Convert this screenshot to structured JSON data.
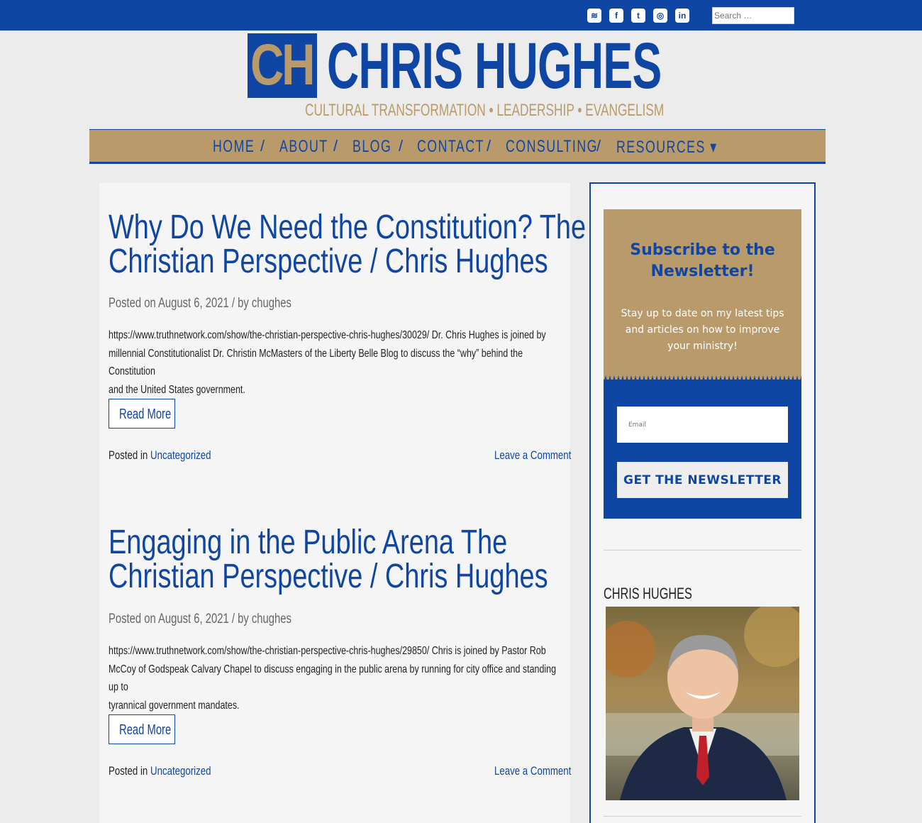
{
  "header": {
    "search_placeholder": "Search …",
    "social": [
      {
        "icon": "rss-icon",
        "glyph": "≋"
      },
      {
        "icon": "facebook-icon",
        "glyph": "f"
      },
      {
        "icon": "twitter-icon",
        "glyph": "t"
      },
      {
        "icon": "instagram-icon",
        "glyph": "◎"
      },
      {
        "icon": "linkedin-icon",
        "glyph": "in"
      }
    ]
  },
  "logo": {
    "initials": "CH",
    "name": "CHRIS HUGHES",
    "tagline": "CULTURAL TRANSFORMATION • LEADERSHIP • EVANGELISM"
  },
  "nav": {
    "items": [
      "HOME",
      "ABOUT",
      "BLOG",
      "CONTACT",
      "CONSULTING",
      "RESOURCES ▾"
    ],
    "separator": "/"
  },
  "posts": [
    {
      "title_line1": "Why Do We Need the Constitution? The",
      "title_line2": "Christian Perspective / Chris Hughes",
      "meta": "Posted on August 6, 2021 / by chughes",
      "excerpt_line1": "https://www.truthnetwork.com/show/the-christian-perspective-chris-hughes/30029/ Dr. Chris Hughes is joined by",
      "excerpt_line2": "millennial Constitutionalist Dr. Christin McMasters of the Liberty Belle Blog to discuss the “why” behind the Constitution",
      "excerpt_line3": "and the United States government.",
      "read_more": "Read More",
      "posted_in": "Posted in",
      "category": "Uncategorized",
      "comment": "Leave a Comment"
    },
    {
      "title_line1": "Engaging in the Public Arena The",
      "title_line2": "Christian Perspective / Chris Hughes",
      "meta": "Posted on August 6, 2021 / by chughes",
      "excerpt_line1": "https://www.truthnetwork.com/show/the-christian-perspective-chris-hughes/29850/ Chris is joined by Pastor Rob",
      "excerpt_line2": "McCoy of Godspeak Calvary Chapel to discuss engaging in the public arena by running for city office and standing up to",
      "excerpt_line3": "tyrannical government mandates.",
      "read_more": "Read More",
      "posted_in": "Posted in",
      "category": "Uncategorized",
      "comment": "Leave a Comment"
    }
  ],
  "sidebar": {
    "newsletter_title": "Subscribe to the Newsletter!",
    "newsletter_text": "Stay up to date on my latest tips and articles on how to improve your ministry!",
    "email_placeholder": "Email",
    "button_label": "GET THE NEWSLETTER",
    "about_title": "CHRIS HUGHES"
  },
  "colors": {
    "brand_blue": "#0f46a3",
    "brand_gold": "#b99b6b"
  }
}
